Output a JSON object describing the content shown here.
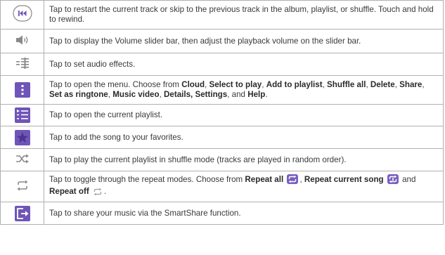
{
  "rows": [
    {
      "icon": "rewind-previous-icon",
      "text": "Tap to restart the current track or skip to the previous track in the album, playlist, or shuffle. Touch and hold to rewind."
    },
    {
      "icon": "volume-icon",
      "text": "Tap to display the Volume slider bar, then adjust the playback volume on the slider bar."
    },
    {
      "icon": "audio-effects-icon",
      "text": "Tap to set audio effects."
    },
    {
      "icon": "menu-icon",
      "text_parts": [
        "Tap to open the menu. Choose from ",
        "Cloud",
        ", ",
        "Select to play",
        ", ",
        "Add to playlist",
        ", ",
        "Shuffle all",
        ", ",
        "Delete",
        ", ",
        "Share",
        ", ",
        "Set as ringtone",
        ", ",
        "Music video",
        ", ",
        "Details, Settings",
        ", and ",
        "Help",
        "."
      ]
    },
    {
      "icon": "playlist-icon",
      "text": "Tap to open the current playlist."
    },
    {
      "icon": "favorite-star-icon",
      "text": "Tap to add the song to your favorites."
    },
    {
      "icon": "shuffle-icon",
      "text": "Tap to play the current playlist in shuffle mode (tracks are played in random order)."
    },
    {
      "icon": "repeat-icon",
      "text_parts": [
        "Tap to toggle through the repeat modes. Choose from ",
        "Repeat all",
        ", ",
        "Repeat current song",
        " and ",
        "Repeat off",
        "."
      ]
    },
    {
      "icon": "share-icon",
      "text": "Tap to share your music via the SmartShare function."
    }
  ],
  "colors": {
    "accent": "#6f55b8",
    "repeat_active": "#7a60c0",
    "icon_gray": "#8a8a8a",
    "border": "#b0b0b0"
  }
}
